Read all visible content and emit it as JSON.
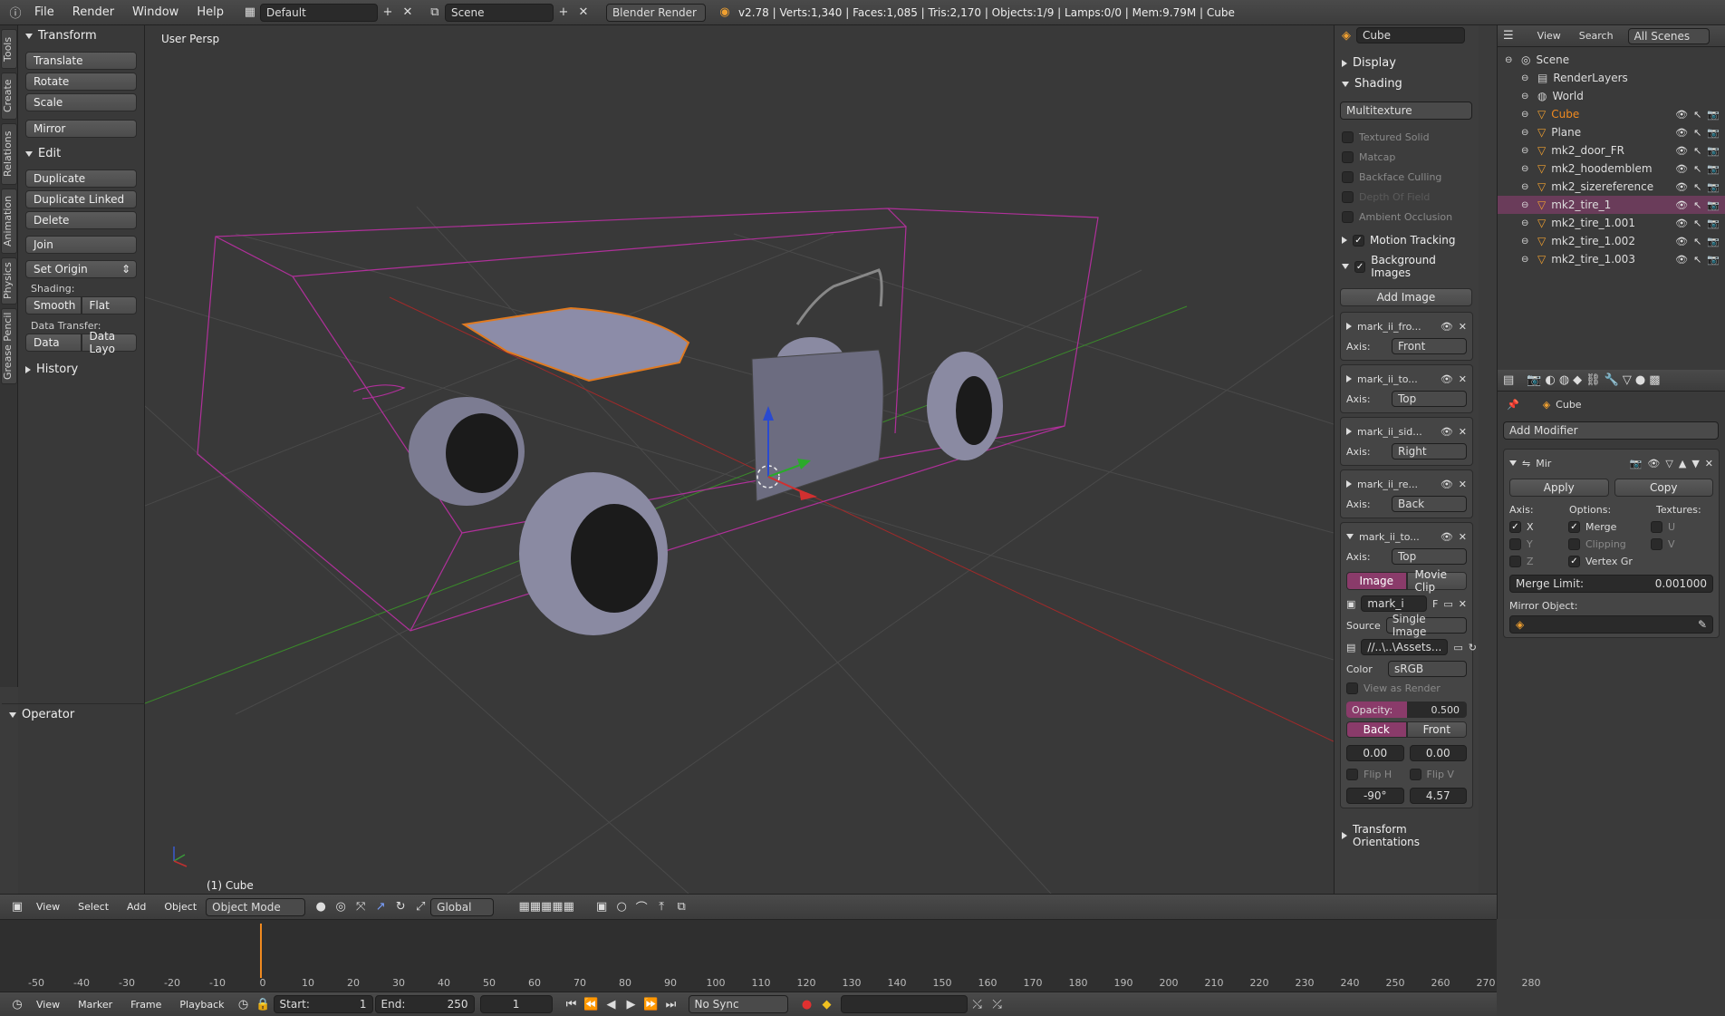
{
  "topbar": {
    "menus": [
      "File",
      "Render",
      "Window",
      "Help"
    ],
    "layout_name": "Default",
    "scene_name": "Scene",
    "engine": "Blender Render",
    "stats": "v2.78 | Verts:1,340 | Faces:1,085 | Tris:2,170 | Objects:1/9 | Lamps:0/0 | Mem:9.79M | Cube"
  },
  "tabs": [
    "Tools",
    "Create",
    "Relations",
    "Animation",
    "Physics",
    "Grease Pencil"
  ],
  "toolshelf": {
    "transform_title": "Transform",
    "transform_buttons": [
      "Translate",
      "Rotate",
      "Scale"
    ],
    "mirror": "Mirror",
    "edit_title": "Edit",
    "edit_buttons": [
      "Duplicate",
      "Duplicate Linked",
      "Delete"
    ],
    "join": "Join",
    "set_origin": "Set Origin",
    "shading_label": "Shading:",
    "smooth": "Smooth",
    "flat": "Flat",
    "data_transfer_label": "Data Transfer:",
    "data": "Data",
    "data_layo": "Data Layo",
    "history_title": "History",
    "operator_title": "Operator"
  },
  "viewport": {
    "persp_label": "User Persp",
    "object_label": "(1) Cube"
  },
  "npanel": {
    "object_name": "Cube",
    "display": "Display",
    "shading": "Shading",
    "shading_mode": "Multitexture",
    "shading_opts": [
      "Textured Solid",
      "Matcap",
      "Backface Culling",
      "Depth Of Field",
      "Ambient Occlusion"
    ],
    "motion_tracking": "Motion Tracking",
    "background_images": "Background Images",
    "add_image": "Add Image",
    "axis_label": "Axis:",
    "images": [
      {
        "name": "mark_ii_fro...",
        "axis": "Front"
      },
      {
        "name": "mark_ii_to...",
        "axis": "Top"
      },
      {
        "name": "mark_ii_sid...",
        "axis": "Right"
      },
      {
        "name": "mark_ii_re...",
        "axis": "Back"
      },
      {
        "name": "mark_ii_to...",
        "axis": "Top"
      }
    ],
    "image_tab": "Image",
    "movie_clip_tab": "Movie Clip",
    "image_datablock": "mark_i",
    "image_f": "F",
    "source_label": "Source",
    "source_value": "Single Image",
    "path": "//..\\..\\Assets...",
    "color_label": "Color",
    "color_value": "sRGB",
    "view_as_render": "View as Render",
    "opacity_label": "Opacity:",
    "opacity_value": "0.500",
    "back": "Back",
    "front": "Front",
    "offset_x": "0.00",
    "offset_y": "0.00",
    "flip_h": "Flip H",
    "flip_v": "Flip V",
    "rotation": "-90°",
    "size": "4.57",
    "transform_orientations": "Transform Orientations"
  },
  "outliner": {
    "view": "View",
    "search": "Search",
    "all_scenes": "All Scenes",
    "items": [
      {
        "name": "Scene",
        "indent": 0
      },
      {
        "name": "RenderLayers",
        "indent": 1
      },
      {
        "name": "World",
        "indent": 1
      },
      {
        "name": "Cube",
        "indent": 1
      },
      {
        "name": "Plane",
        "indent": 1
      },
      {
        "name": "mk2_door_FR",
        "indent": 1
      },
      {
        "name": "mk2_hoodemblem",
        "indent": 1
      },
      {
        "name": "mk2_sizereference",
        "indent": 1
      },
      {
        "name": "mk2_tire_1",
        "indent": 1
      },
      {
        "name": "mk2_tire_1.001",
        "indent": 1
      },
      {
        "name": "mk2_tire_1.002",
        "indent": 1
      },
      {
        "name": "mk2_tire_1.003",
        "indent": 1
      }
    ]
  },
  "props": {
    "object_name": "Cube",
    "add_modifier": "Add Modifier",
    "modifier_name": "Mir",
    "apply": "Apply",
    "copy": "Copy",
    "axis_label": "Axis:",
    "options_label": "Options:",
    "textures_label": "Textures:",
    "x": "X",
    "y": "Y",
    "z": "Z",
    "merge": "Merge",
    "clipping": "Clipping",
    "vertex_gr": "Vertex Gr",
    "u": "U",
    "v": "V",
    "merge_limit_label": "Merge Limit:",
    "merge_limit_value": "0.001000",
    "mirror_object": "Mirror Object:"
  },
  "vp_header": {
    "menus": [
      "View",
      "Select",
      "Add",
      "Object"
    ],
    "mode": "Object Mode",
    "orientation": "Global"
  },
  "timeline": {
    "ticks": [
      "-50",
      "-40",
      "-30",
      "-20",
      "-10",
      "0",
      "10",
      "20",
      "30",
      "40",
      "50",
      "60",
      "70",
      "80",
      "90",
      "100",
      "110",
      "120",
      "130",
      "140",
      "150",
      "160",
      "170",
      "180",
      "190",
      "200",
      "210",
      "220",
      "230",
      "240",
      "250",
      "260",
      "270",
      "280"
    ]
  },
  "tl_header": {
    "menus": [
      "View",
      "Marker",
      "Frame",
      "Playback"
    ],
    "start_label": "Start:",
    "start_value": "1",
    "end_label": "End:",
    "end_value": "250",
    "current_frame": "1",
    "sync": "No Sync"
  },
  "colors": {
    "selected_outline": "#e07a20",
    "bbox_magenta": "#b0309a",
    "accent_pink": "#8a3b6a"
  }
}
